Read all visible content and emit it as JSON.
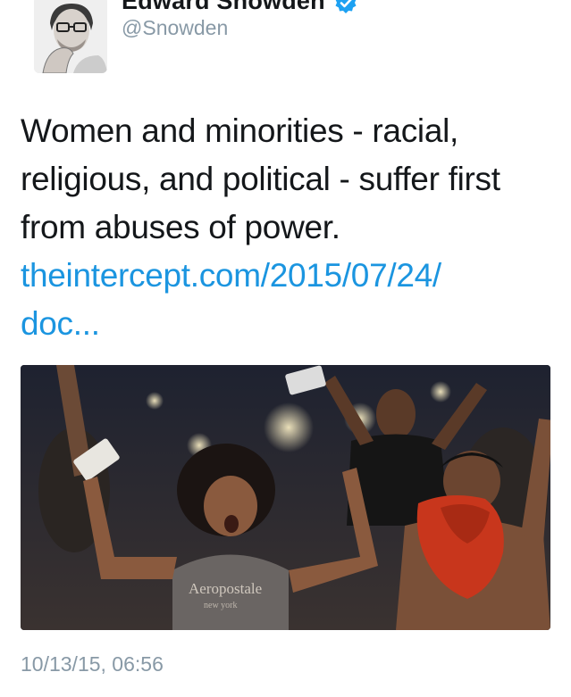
{
  "tweet": {
    "display_name": "Edward Snowden",
    "handle": "@Snowden",
    "text": "Women and minorities - racial, religious, and political - suffer first from abuses of power.",
    "link_line1": "theintercept.com/2015/07/24/",
    "link_line2": "doc...",
    "media_shirt_text": "Aeropostale",
    "media_shirt_subtext": "new york",
    "timestamp": "10/13/15, 06:56"
  },
  "colors": {
    "text": "#14171a",
    "secondary": "#8899a6",
    "link": "#1b95e0",
    "verified": "#1da1f2"
  },
  "icons": {
    "verified": "verified-badge-icon"
  }
}
